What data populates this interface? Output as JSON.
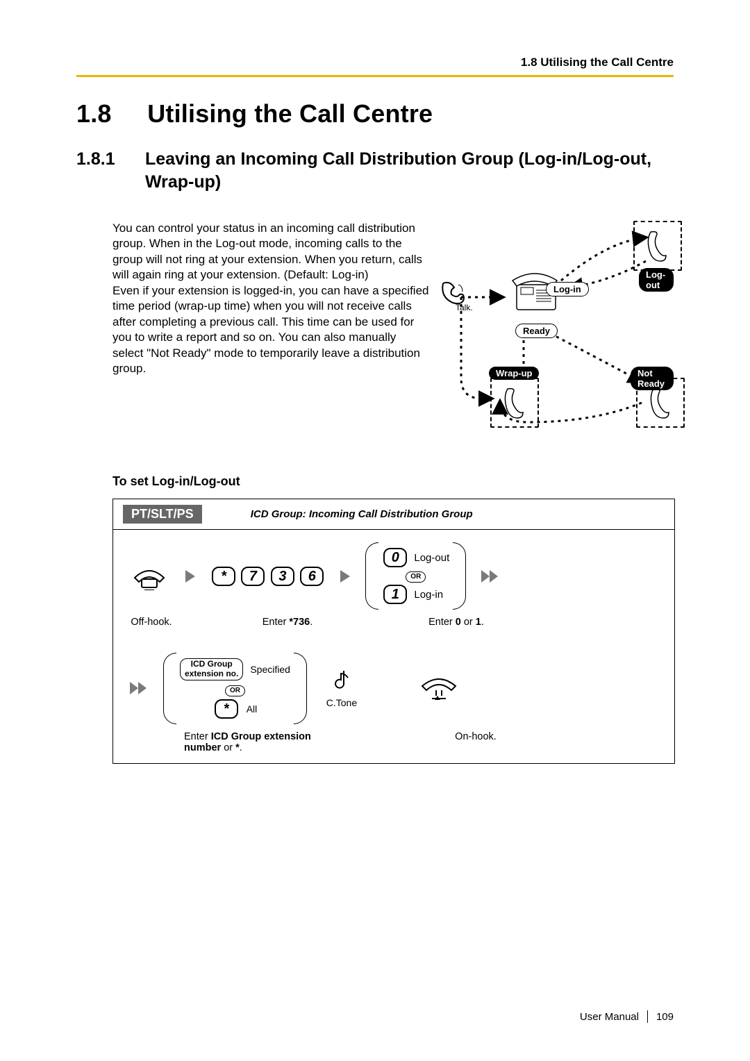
{
  "running_head": "1.8 Utilising the Call Centre",
  "title": {
    "number": "1.8",
    "text": "Utilising the Call Centre"
  },
  "section": {
    "number": "1.8.1",
    "text": "Leaving an Incoming Call Distribution Group (Log-in/Log-out, Wrap-up)"
  },
  "intro": "You can control your status in an incoming call distribution group. When in the Log-out mode, incoming calls to the group will not ring at your extension. When you return, calls will again ring at your extension. (Default: Log-in)\nEven if your extension is logged-in, you can have a specified time period (wrap-up time) when you will not receive calls after completing a previous call. This time can be used for you to write a report and so on. You can also manually select \"Not Ready\" mode to temporarily leave a distribution group.",
  "diagram": {
    "talk": "Talk.",
    "login": "Log-in",
    "logout": "Log-out",
    "ready": "Ready",
    "wrapup": "Wrap-up",
    "notready": "Not Ready"
  },
  "procedure_title": "To set Log-in/Log-out",
  "procedure": {
    "device_tag": "PT/SLT/PS",
    "subtitle": "ICD Group: Incoming Call Distribution Group",
    "row1": {
      "offhook_caption": "Off-hook.",
      "keys": [
        "*",
        "7",
        "3",
        "6"
      ],
      "keys_caption_prefix": "Enter ",
      "keys_caption_bold": "*736",
      "keys_caption_suffix": ".",
      "opt0": "0",
      "opt0_label": "Log-out",
      "or": "OR",
      "opt1": "1",
      "opt1_label": "Log-in",
      "opt_caption_prefix": "Enter ",
      "opt_caption_bold": "0",
      "opt_caption_mid": " or ",
      "opt_caption_bold2": "1",
      "opt_caption_suffix": "."
    },
    "row2": {
      "group_label_line1": "ICD Group",
      "group_label_line2": "extension no.",
      "specified": "Specified",
      "or": "OR",
      "star": "*",
      "all": "All",
      "ctone": "C.Tone",
      "onhook_caption": "On-hook.",
      "caption_prefix": "Enter ",
      "caption_bold1": "ICD Group extension",
      "caption_line2_bold": "number",
      "caption_mid": " or ",
      "caption_star": "*",
      "caption_suffix": "."
    }
  },
  "footer": {
    "label": "User Manual",
    "page": "109"
  }
}
